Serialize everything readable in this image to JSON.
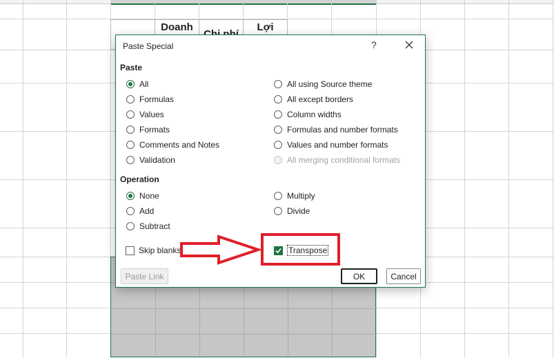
{
  "spreadsheet": {
    "headers": [
      "Doanh",
      "Chi phí",
      "Lợi"
    ]
  },
  "dialog": {
    "title": "Paste Special",
    "help": "?",
    "paste_group": "Paste",
    "paste_left": [
      "All",
      "Formulas",
      "Values",
      "Formats",
      "Comments and Notes",
      "Validation"
    ],
    "paste_right": [
      "All using Source theme",
      "All except borders",
      "Column widths",
      "Formulas and number formats",
      "Values and number formats",
      "All merging conditional formats"
    ],
    "operation_group": "Operation",
    "op_left": [
      "None",
      "Add",
      "Subtract"
    ],
    "op_right": [
      "Multiply",
      "Divide"
    ],
    "skip_blanks": "Skip blanks",
    "transpose": "Transpose",
    "paste_link": "Paste Link",
    "ok": "OK",
    "cancel": "Cancel",
    "selected_paste": "All",
    "selected_operation": "None",
    "transpose_checked": true,
    "skip_blanks_checked": false
  },
  "colors": {
    "accent": "#217346",
    "annotation": "#e0202a"
  }
}
